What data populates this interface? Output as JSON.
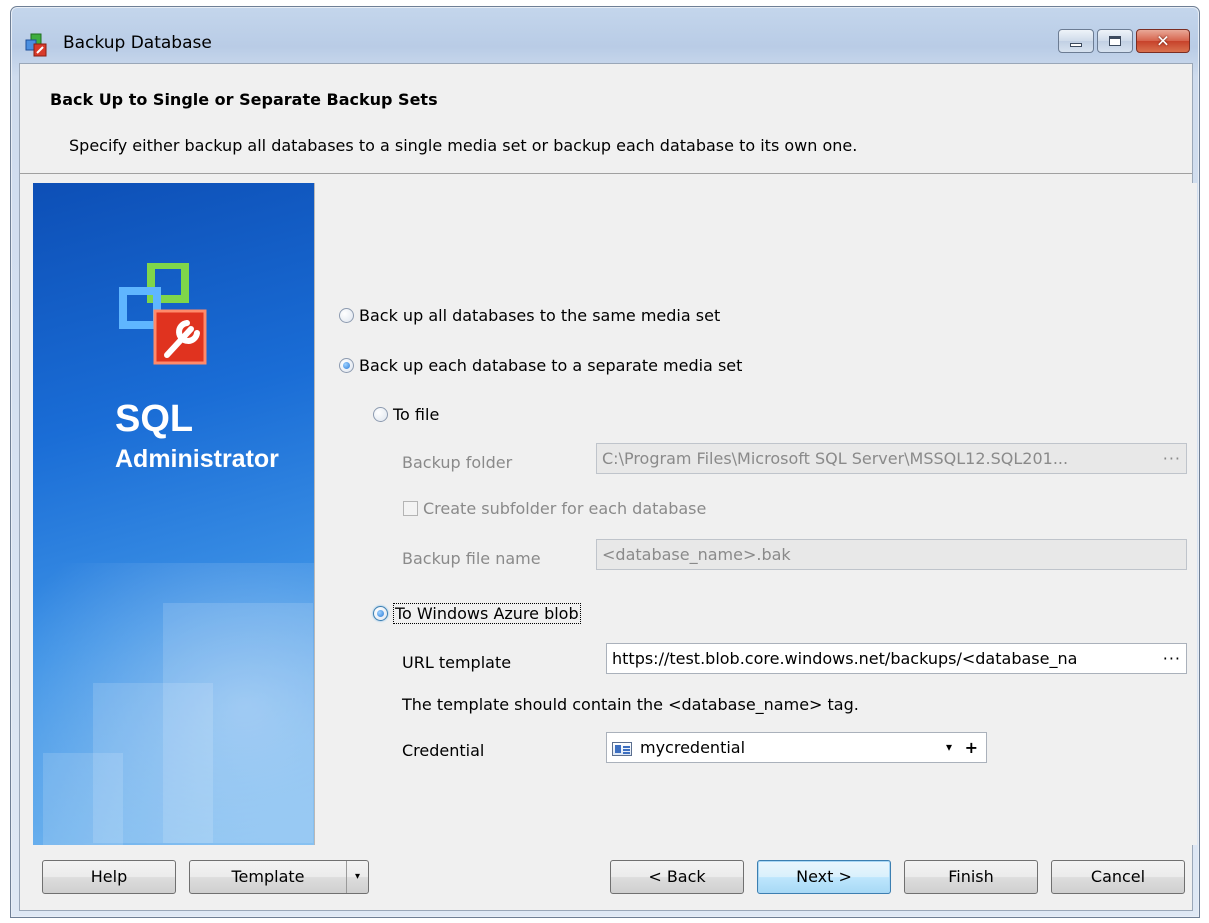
{
  "window": {
    "title": "Backup Database",
    "controls": [
      "minimize-icon",
      "maximize-icon",
      "close-icon"
    ]
  },
  "header": {
    "title": "Back Up to Single or Separate Backup Sets",
    "description": "Specify either backup all databases to a single media set or backup each database to its own one."
  },
  "banner": {
    "brand_line1": "SQL",
    "brand_line2": "Administrator"
  },
  "options": {
    "same_media_set": "Back up all databases to the same media set",
    "separate_media_set": "Back up each database to a separate media set",
    "to_file": "To file",
    "backup_folder_label": "Backup folder",
    "backup_folder_value": "C:\\Program Files\\Microsoft SQL Server\\MSSQL12.SQL201...",
    "create_subfolder": "Create subfolder for each database",
    "backup_file_name_label": "Backup file name",
    "backup_file_name_value": "<database_name>.bak",
    "to_azure": "To Windows Azure blob",
    "url_template_label": "URL template",
    "url_template_value": "https://test.blob.core.windows.net/backups/<database_na",
    "template_hint": "The template should contain the <database_name> tag.",
    "credential_label": "Credential",
    "credential_value": "mycredential",
    "ellipsis": "···",
    "dropdown_arrow": "▾",
    "add_glyph": "+"
  },
  "footer": {
    "help": "Help",
    "template": "Template",
    "back": "< Back",
    "next": "Next >",
    "finish": "Finish",
    "cancel": "Cancel"
  }
}
